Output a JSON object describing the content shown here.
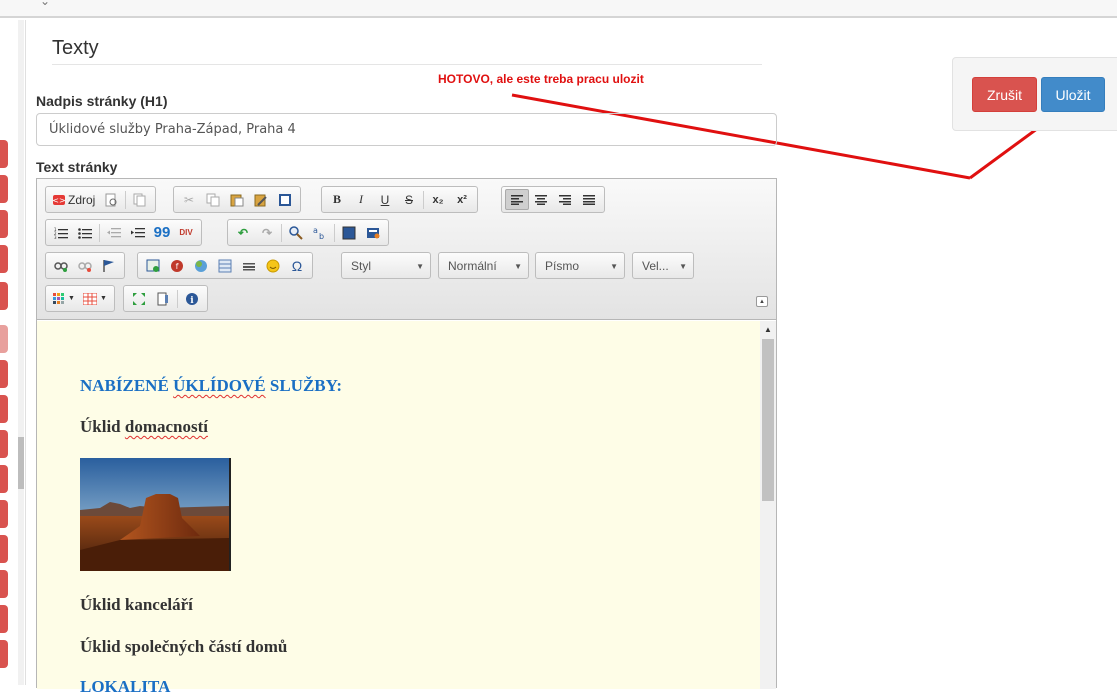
{
  "section": {
    "title": "Texty"
  },
  "annotation": {
    "text": "HOTOVO, ale este treba pracu ulozit"
  },
  "heading_field": {
    "label": "Nadpis stránky (H1)",
    "value": "Úklidové služby Praha-Západ, Praha 4"
  },
  "text_field": {
    "label": "Text stránky"
  },
  "toolbar": {
    "source_label": "Zdroj",
    "style_combo": "Styl",
    "format_combo": "Normální",
    "font_combo": "Písmo",
    "size_combo": "Vel...",
    "subscript": "x₂",
    "superscript": "x²",
    "blockquote": "99",
    "div": "DIV",
    "omega": "Ω",
    "bold": "B",
    "italic": "I",
    "underline": "U",
    "strike": "S"
  },
  "content": {
    "heading1_part1": "NABÍZENÉ ",
    "heading1_part2": "ÚKLÍDOVÉ",
    "heading1_part3": " SLUŽBY:",
    "item1_part1": "Úklid ",
    "item1_part2": "domacností",
    "item2": "Úklid kanceláří",
    "item3": "Úklid společných částí domů",
    "heading2": "LOKALITA"
  },
  "buttons": {
    "cancel": "Zrušit",
    "save": "Uložit"
  },
  "colors": {
    "cancel": "#d9534f",
    "save": "#428bca",
    "annotation": "#e01010",
    "content_bg": "#fefde7",
    "heading_blue": "#1a6fc4"
  }
}
